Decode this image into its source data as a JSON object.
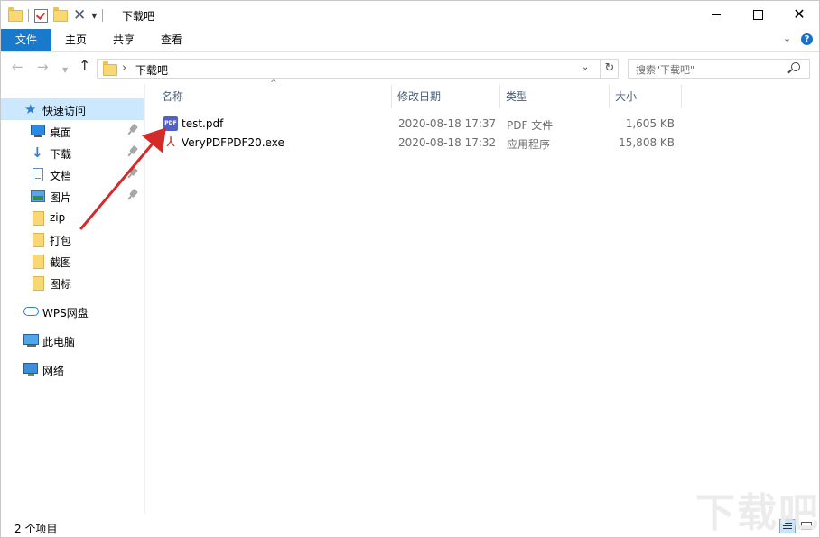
{
  "window": {
    "title": "下载吧"
  },
  "ribbon": {
    "tabs": [
      "文件",
      "主页",
      "共享",
      "查看"
    ]
  },
  "nav": {
    "address": "下载吧",
    "search_placeholder": "搜索\"下载吧\""
  },
  "sidebar": {
    "quick_access": "快速访问",
    "items": [
      {
        "label": "桌面",
        "icon": "desktop-icon",
        "pinned": true
      },
      {
        "label": "下载",
        "icon": "download-icon",
        "pinned": true
      },
      {
        "label": "文档",
        "icon": "document-icon",
        "pinned": true
      },
      {
        "label": "图片",
        "icon": "pictures-icon",
        "pinned": true
      },
      {
        "label": "zip",
        "icon": "folder-icon",
        "pinned": false
      },
      {
        "label": "打包",
        "icon": "folder-icon",
        "pinned": false
      },
      {
        "label": "截图",
        "icon": "folder-icon",
        "pinned": false
      },
      {
        "label": "图标",
        "icon": "folder-icon",
        "pinned": false
      }
    ],
    "wps": "WPS网盘",
    "this_pc": "此电脑",
    "network": "网络"
  },
  "columns": {
    "name": "名称",
    "date": "修改日期",
    "type": "类型",
    "size": "大小"
  },
  "files": [
    {
      "name": "test.pdf",
      "date": "2020-08-18 17:37",
      "type": "PDF 文件",
      "size": "1,605 KB",
      "icon": "pdf-icon"
    },
    {
      "name": "VeryPDFPDF20.exe",
      "date": "2020-08-18 17:32",
      "type": "应用程序",
      "size": "15,808 KB",
      "icon": "acrobat-icon"
    }
  ],
  "status": {
    "count": "2 个项目"
  },
  "watermark": {
    "text": "下载吧"
  },
  "colors": {
    "accent": "#1979ca",
    "selection": "#cce8ff",
    "arrow": "#d42a2a"
  }
}
